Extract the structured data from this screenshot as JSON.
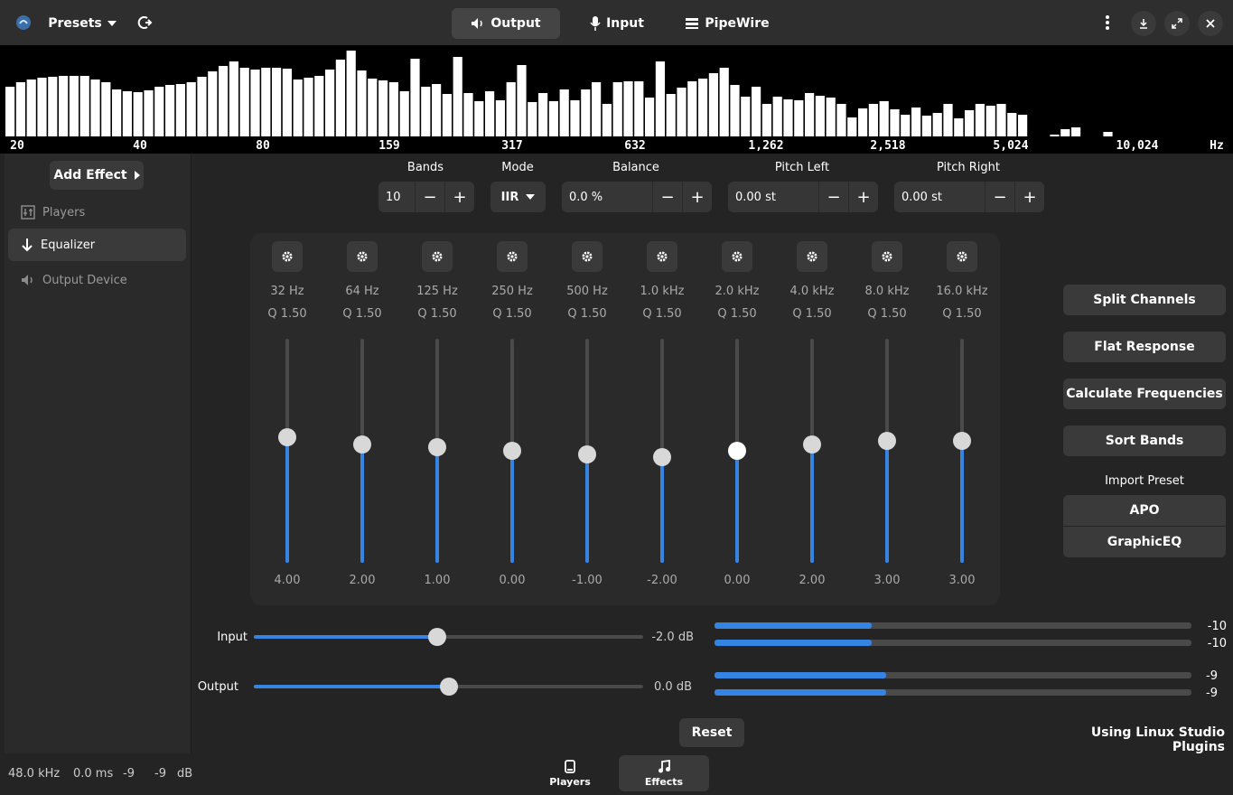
{
  "header": {
    "presets_label": "Presets",
    "tabs": [
      {
        "label": "Output",
        "icon": "speaker-icon",
        "active": true
      },
      {
        "label": "Input",
        "icon": "microphone-icon",
        "active": false
      },
      {
        "label": "PipeWire",
        "icon": "server-icon",
        "active": false
      }
    ]
  },
  "spectrum": {
    "values": [
      0.55,
      0.6,
      0.63,
      0.65,
      0.66,
      0.67,
      0.67,
      0.67,
      0.63,
      0.6,
      0.52,
      0.5,
      0.49,
      0.51,
      0.55,
      0.57,
      0.58,
      0.6,
      0.66,
      0.72,
      0.78,
      0.83,
      0.76,
      0.74,
      0.76,
      0.76,
      0.75,
      0.63,
      0.65,
      0.67,
      0.74,
      0.85,
      0.95,
      0.73,
      0.64,
      0.62,
      0.6,
      0.5,
      0.86,
      0.55,
      0.58,
      0.47,
      0.88,
      0.48,
      0.39,
      0.5,
      0.4,
      0.6,
      0.79,
      0.38,
      0.48,
      0.39,
      0.52,
      0.4,
      0.52,
      0.6,
      0.36,
      0.6,
      0.61,
      0.61,
      0.43,
      0.83,
      0.47,
      0.54,
      0.61,
      0.64,
      0.7,
      0.76,
      0.57,
      0.44,
      0.55,
      0.36,
      0.44,
      0.41,
      0.4,
      0.48,
      0.45,
      0.43,
      0.36,
      0.21,
      0.31,
      0.36,
      0.39,
      0.3,
      0.24,
      0.32,
      0.23,
      0.26,
      0.36,
      0.2,
      0.29,
      0.36,
      0.34,
      0.36,
      0.26,
      0.24,
      0,
      0,
      0.02,
      0.08,
      0.1,
      0,
      0,
      0.05,
      0
    ],
    "labels": [
      "20",
      "40",
      "80",
      "159",
      "317",
      "632",
      "1,262",
      "2,518",
      "5,024",
      "10,024",
      "Hz"
    ]
  },
  "sidebar": {
    "add_effect_label": "Add Effect",
    "items": [
      {
        "label": "Players",
        "icon": "players-icon",
        "selected": false
      },
      {
        "label": "Equalizer",
        "icon": "arrow-down-icon",
        "selected": true
      },
      {
        "label": "Output Device",
        "icon": "speaker-icon",
        "selected": false
      }
    ]
  },
  "controls": {
    "bands": {
      "label": "Bands",
      "value": "10"
    },
    "mode": {
      "label": "Mode",
      "value": "IIR"
    },
    "balance": {
      "label": "Balance",
      "value": "0.0 %"
    },
    "pitch_left": {
      "label": "Pitch Left",
      "value": "0.00 st"
    },
    "pitch_right": {
      "label": "Pitch Right",
      "value": "0.00 st"
    }
  },
  "bands": [
    {
      "freq": "32 Hz",
      "q": "Q 1.50",
      "gain": "4.00",
      "level": 0.56
    },
    {
      "freq": "64 Hz",
      "q": "Q 1.50",
      "gain": "2.00",
      "level": 0.53
    },
    {
      "freq": "125 Hz",
      "q": "Q 1.50",
      "gain": "1.00",
      "level": 0.515
    },
    {
      "freq": "250 Hz",
      "q": "Q 1.50",
      "gain": "0.00",
      "level": 0.5
    },
    {
      "freq": "500 Hz",
      "q": "Q 1.50",
      "gain": "-1.00",
      "level": 0.485
    },
    {
      "freq": "1.0 kHz",
      "q": "Q 1.50",
      "gain": "-2.00",
      "level": 0.47
    },
    {
      "freq": "2.0 kHz",
      "q": "Q 1.50",
      "gain": "0.00",
      "level": 0.5
    },
    {
      "freq": "4.0 kHz",
      "q": "Q 1.50",
      "gain": "2.00",
      "level": 0.53
    },
    {
      "freq": "8.0 kHz",
      "q": "Q 1.50",
      "gain": "3.00",
      "level": 0.545
    },
    {
      "freq": "16.0 kHz",
      "q": "Q 1.50",
      "gain": "3.00",
      "level": 0.545
    }
  ],
  "actions": {
    "split": "Split Channels",
    "flat": "Flat Response",
    "calc": "Calculate Frequencies",
    "sort": "Sort Bands",
    "import_label": "Import Preset",
    "apo": "APO",
    "graphiceq": "GraphicEQ"
  },
  "gains": {
    "input": {
      "label": "Input",
      "value": "-2.0 dB",
      "level": 0.47
    },
    "output": {
      "label": "Output",
      "value": "0.0 dB",
      "level": 0.5
    }
  },
  "meters": {
    "input_values": [
      "-10",
      "-10"
    ],
    "input_levels": [
      0.33,
      0.33
    ],
    "output_values": [
      "-9",
      "-9"
    ],
    "output_levels": [
      0.36,
      0.36
    ]
  },
  "footer": {
    "reset": "Reset",
    "plugins_text": "Using Linux Studio Plugins",
    "sample_rate": "48.0 kHz",
    "latency": "0.0 ms",
    "level_l": "-9",
    "level_r": "-9",
    "level_unit": "dB",
    "nav": [
      {
        "label": "Players",
        "active": false
      },
      {
        "label": "Effects",
        "active": true
      }
    ]
  },
  "colors": {
    "accent": "#3584e4",
    "background": "#242424",
    "panel": "#2a2a2a"
  }
}
